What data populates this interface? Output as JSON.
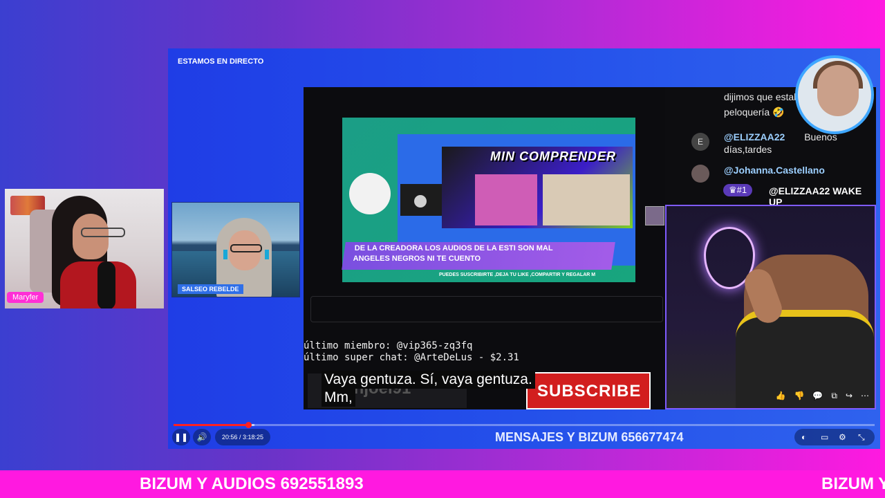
{
  "left_cam": {
    "name_tag": "Maryfer"
  },
  "main": {
    "title": "ESTAMOS EN DIRECTO",
    "guest_label": "SALSEO REBELDE",
    "stream": {
      "promo_title": "MIN COMPRENDER",
      "banner_line1": "DE LA CREADORA LOS AUDIOS DE LA ESTI SON MAL",
      "banner_line2": "ANGELES NEGROS NI TE CUENTO",
      "banner_sub": "PUEDES SUSCRIBIRTE ,DEJA TU LIKE ,COMPARTIR Y REGALAR M",
      "last_member": "último miembro: @vip365-zq3fq",
      "last_superchat": "último super chat: @ArteDeLus - $2.31",
      "handle": "eltonjoel91",
      "subscribe": "SUBSCRIBE",
      "caption_line1": "Vaya gentuza. Sí, vaya gentuza.",
      "caption_line2": "Mm,"
    },
    "chat": {
      "msg1_line1": "dijimos que estaba",
      "msg1_line2": "peloquería 🤣",
      "msg2_avatar": "E",
      "msg2_user": "@ELIZZAA22",
      "msg2_text_a": "Buenos",
      "msg2_text_b": "días,tardes",
      "msg3_user": "@Johanna.Castellano",
      "rank": "♛#1",
      "rank_msg": "@ELIZZAA22 WAKE UP"
    },
    "host_icons": [
      "👍",
      "👎",
      "💬",
      "⧉",
      "↪",
      "⋯"
    ],
    "controls": {
      "pause_icon": "❚❚",
      "volume_icon": "🔊",
      "time": "20:56 / 3:18:25",
      "played_fraction": 0.107,
      "buffered_fraction": 0.115,
      "center_text": "MENSAJES Y BIZUM 656677474",
      "toggle_icon": "◐",
      "subtitles_icon": "▭",
      "settings_icon": "⚙",
      "exit_icon": "⤡"
    }
  },
  "ticker": {
    "text": "BIZUM Y AUDIOS 692551893",
    "text_repeat": "BIZUM Y"
  },
  "colors": {
    "accent_pink": "#ff19e0",
    "frame_blue": "#2450ea",
    "progress_red": "#ff2020"
  }
}
